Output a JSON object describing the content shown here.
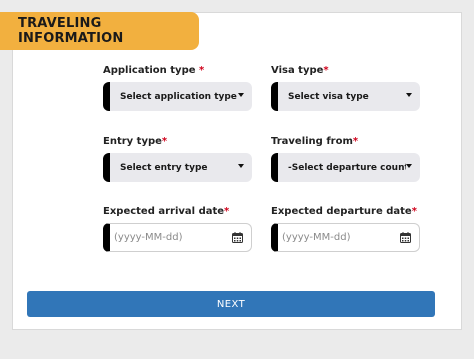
{
  "section_title": "TRAVELING INFORMATION",
  "required_mark": "*",
  "fields": {
    "application_type": {
      "label": "Application type",
      "value": "Select application type"
    },
    "visa_type": {
      "label": "Visa type",
      "value": "Select visa type"
    },
    "entry_type": {
      "label": "Entry type",
      "value": "Select entry type"
    },
    "traveling_from": {
      "label": "Traveling from",
      "value": "-Select departure country"
    },
    "arrival_date": {
      "label": "Expected arrival date",
      "placeholder": "(yyyy-MM-dd)"
    },
    "departure_date": {
      "label": "Expected departure date",
      "placeholder": "(yyyy-MM-dd)"
    }
  },
  "next_button": "NEXT",
  "icons": {
    "dropdown": "chevron-down-icon",
    "date": "calendar-icon"
  },
  "colors": {
    "header_accent": "#f2b03f",
    "button": "#3176b8",
    "required": "#d0021b"
  }
}
